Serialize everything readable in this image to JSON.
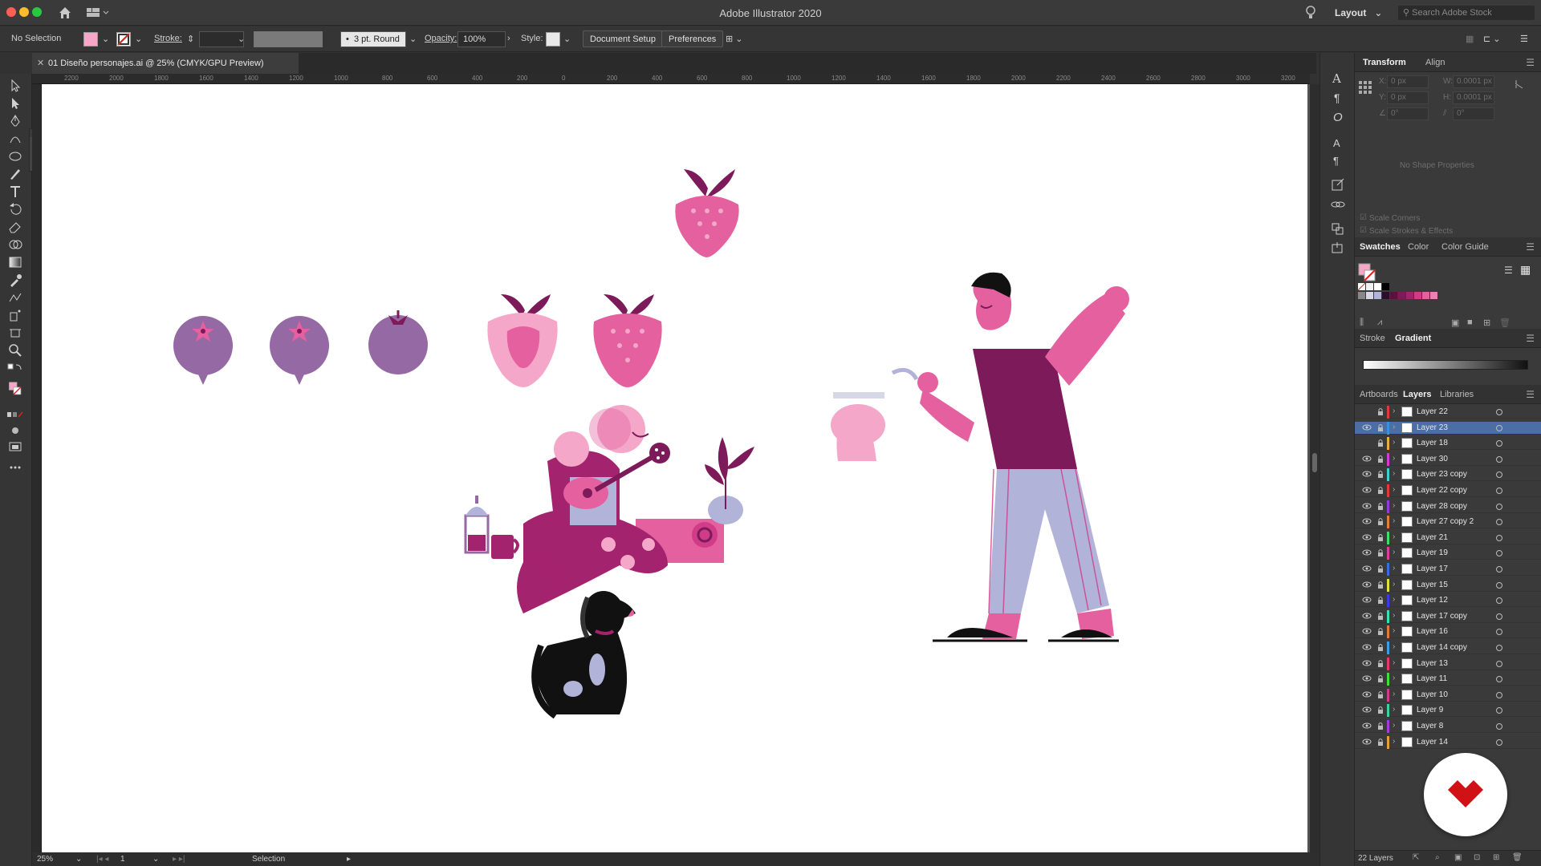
{
  "window": {
    "title": "Adobe Illustrator 2020"
  },
  "titlebar": {
    "layout_label": "Layout",
    "search_placeholder": "Search Adobe Stock"
  },
  "control": {
    "selection_label": "No Selection",
    "stroke_label": "Stroke:",
    "brush_label": "3 pt. Round",
    "opacity_label": "Opacity:",
    "opacity_value": "100%",
    "style_label": "Style:",
    "document_setup": "Document Setup",
    "preferences": "Preferences"
  },
  "document": {
    "tab_title": "01 Diseño personajes.ai @ 25% (CMYK/GPU Preview)"
  },
  "rulers": {
    "top_ticks": [
      "2200",
      "2000",
      "1800",
      "1600",
      "1400",
      "1200",
      "1000",
      "800",
      "600",
      "400",
      "200",
      "0",
      "200",
      "400",
      "600",
      "800",
      "1000",
      "1200",
      "1400",
      "1600",
      "1800",
      "2000",
      "2200",
      "2400",
      "2600",
      "2800",
      "3000",
      "3200"
    ]
  },
  "status": {
    "zoom": "25%",
    "artboard_number": "1",
    "tool": "Selection"
  },
  "panels": {
    "transform": {
      "tabs": [
        "Transform",
        "Align"
      ],
      "x_label": "X:",
      "y_label": "Y:",
      "w_label": "W:",
      "h_label": "H:",
      "x_value": "0 px",
      "y_value": "0 px",
      "w_value": "0.0001 px",
      "h_value": "0.0001 px",
      "angle_value": "0°",
      "no_shape": "No Shape Properties",
      "scale_corners": "Scale Corners",
      "scale_strokes": "Scale Strokes & Effects"
    },
    "swatches": {
      "tabs": [
        "Swatches",
        "Color",
        "Color Guide"
      ],
      "colors": [
        "#ffffff",
        "#000000",
        "#2e0d2a",
        "#5a1040",
        "#7d1a5a",
        "#a4236e",
        "#d13c89",
        "#e4609e",
        "#f07fb4",
        "#f4a7c8",
        "#d7d7e8",
        "#b1b3d8"
      ]
    },
    "gradient": {
      "tabs": [
        "Stroke",
        "Gradient"
      ]
    },
    "layers": {
      "tabs": [
        "Artboards",
        "Layers",
        "Libraries"
      ],
      "items": [
        {
          "name": "Layer 22",
          "color": "#e03b3b",
          "visible": false
        },
        {
          "name": "Layer 23",
          "color": "#3b8ee0",
          "visible": true,
          "selected": true
        },
        {
          "name": "Layer 18",
          "color": "#e0b13b",
          "visible": false
        },
        {
          "name": "Layer 30",
          "color": "#d13cd1",
          "visible": true
        },
        {
          "name": "Layer 23 copy",
          "color": "#3bd1d1",
          "visible": true
        },
        {
          "name": "Layer 22 copy",
          "color": "#e03b3b",
          "visible": true
        },
        {
          "name": "Layer 28 copy",
          "color": "#8e3be0",
          "visible": true
        },
        {
          "name": "Layer 27 copy 2",
          "color": "#e0803b",
          "visible": true
        },
        {
          "name": "Layer 21",
          "color": "#3be06b",
          "visible": true
        },
        {
          "name": "Layer 19",
          "color": "#e03b9e",
          "visible": true
        },
        {
          "name": "Layer 17",
          "color": "#3b6be0",
          "visible": true
        },
        {
          "name": "Layer 15",
          "color": "#e0e03b",
          "visible": true
        },
        {
          "name": "Layer 12",
          "color": "#3b3be0",
          "visible": true
        },
        {
          "name": "Layer 17 copy",
          "color": "#3be0b1",
          "visible": true
        },
        {
          "name": "Layer 16",
          "color": "#e07b3b",
          "visible": true
        },
        {
          "name": "Layer 14 copy",
          "color": "#3b9ee0",
          "visible": true
        },
        {
          "name": "Layer 13",
          "color": "#e03b6b",
          "visible": true
        },
        {
          "name": "Layer 11",
          "color": "#3be03b",
          "visible": true
        },
        {
          "name": "Layer 10",
          "color": "#d13c89",
          "visible": true
        },
        {
          "name": "Layer 9",
          "color": "#3bd1a0",
          "visible": true
        },
        {
          "name": "Layer 8",
          "color": "#a03be0",
          "visible": true
        },
        {
          "name": "Layer 14",
          "color": "#e0a03b",
          "visible": true
        }
      ],
      "count": "22 Layers"
    }
  },
  "artwork": {
    "palette": {
      "magenta": "#7d1a5a",
      "pink": "#e4609e",
      "light_pink": "#f4a7c8",
      "purple": "#956aa4",
      "lavender": "#b1b3d8"
    }
  }
}
